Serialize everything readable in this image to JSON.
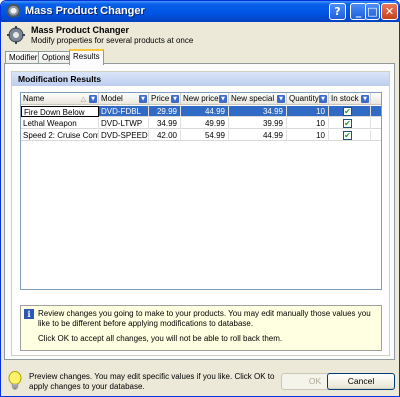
{
  "window": {
    "title": "Mass Product Changer"
  },
  "header": {
    "title": "Mass Product Changer",
    "subtitle": "Modify properties for several products at once"
  },
  "tabs": [
    {
      "label": "Modifier"
    },
    {
      "label": "Options"
    },
    {
      "label": "Results"
    }
  ],
  "results": {
    "group_title": "Modification Results",
    "columns": [
      {
        "label": "Name"
      },
      {
        "label": "Model"
      },
      {
        "label": "Price"
      },
      {
        "label": "New price"
      },
      {
        "label": "New special"
      },
      {
        "label": "Quantity"
      },
      {
        "label": "In stock"
      }
    ],
    "rows": [
      {
        "name": "Fire Down Below",
        "model": "DVD-FDBL",
        "price": "29.99",
        "new_price": "44.99",
        "new_special": "34.99",
        "quantity": "10",
        "in_stock": "✔"
      },
      {
        "name": "Lethal Weapon",
        "model": "DVD-LTWP",
        "price": "34.99",
        "new_price": "49.99",
        "new_special": "39.99",
        "quantity": "10",
        "in_stock": "✔"
      },
      {
        "name": "Speed 2: Cruise Control",
        "model": "DVD-SPEED2",
        "price": "42.00",
        "new_price": "54.99",
        "new_special": "44.99",
        "quantity": "10",
        "in_stock": "✔"
      }
    ]
  },
  "info": {
    "line1": "Review changes you going to make to your products. You may edit manually those values you like to be different before applying modifications to database.",
    "line2": "Click OK to accept all changes, you will not be able to roll back them."
  },
  "footer": {
    "hint": "Preview changes. You may edit specific values if you like. Click OK to apply changes to your database.",
    "ok_label": "OK",
    "cancel_label": "Cancel"
  },
  "colors": {
    "title_bar": "#0054e3",
    "selection": "#316ac5",
    "info_bg": "#ffffe1"
  }
}
